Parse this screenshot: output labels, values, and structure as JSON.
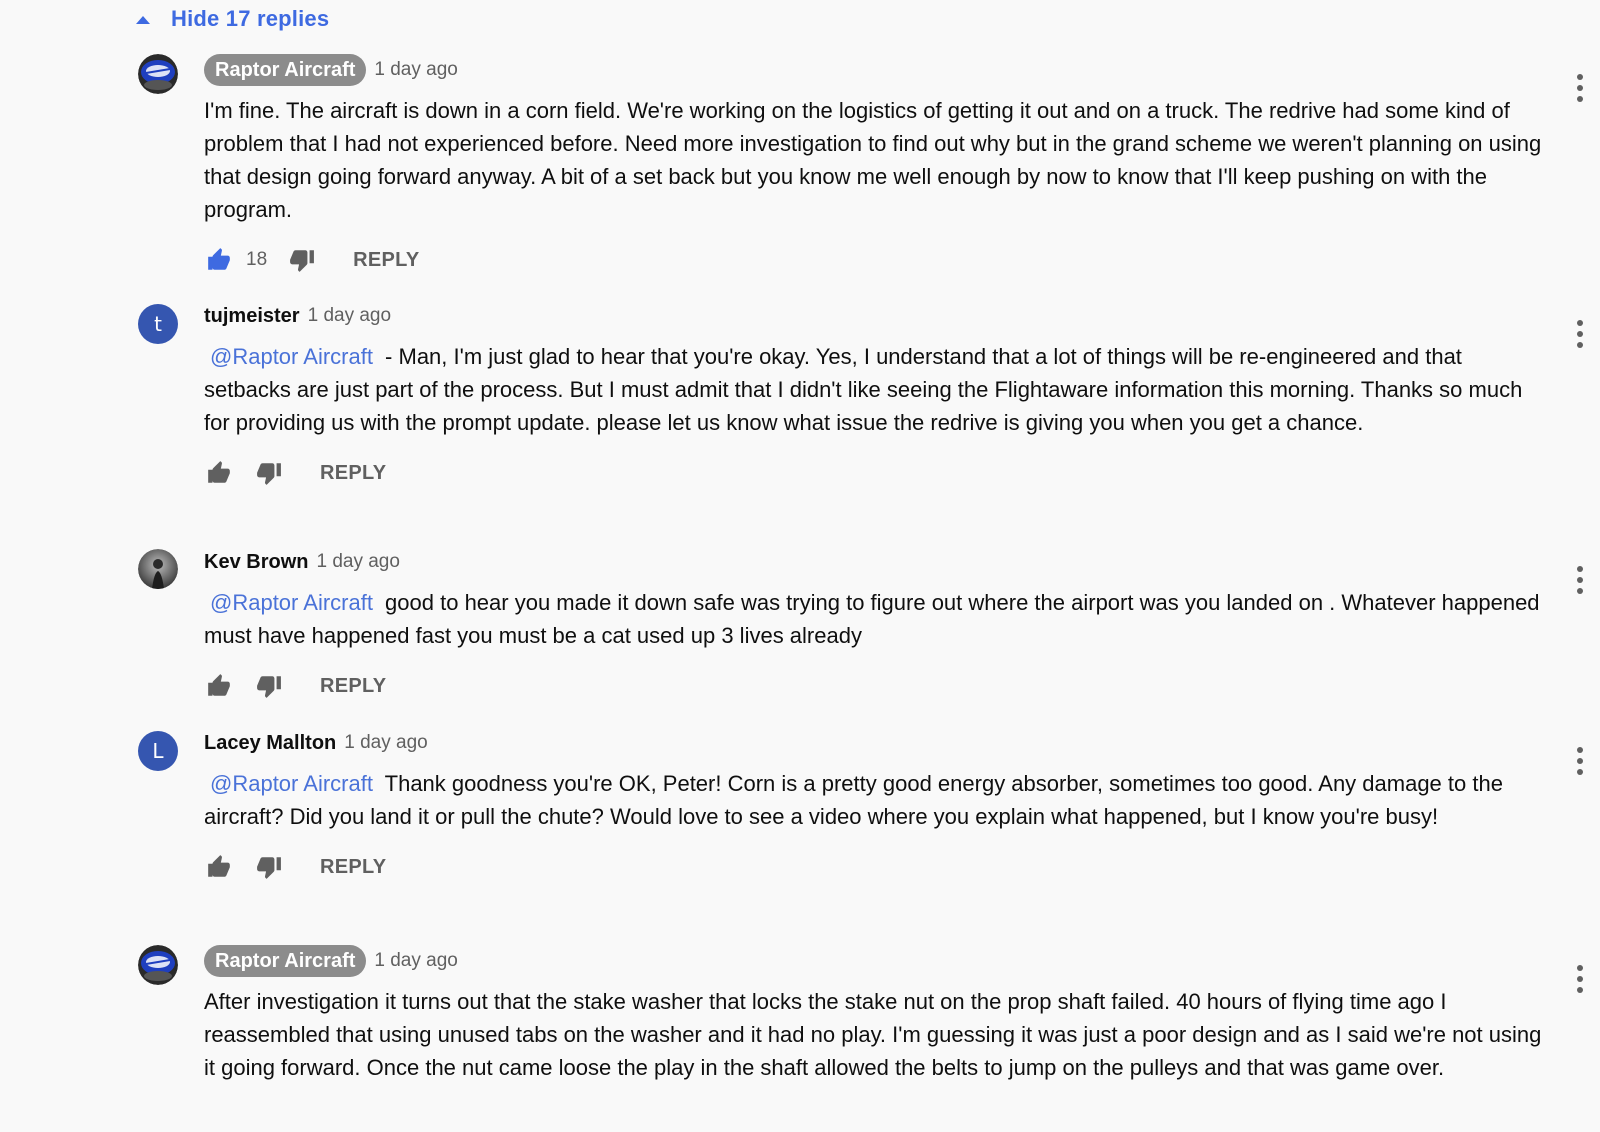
{
  "thread": {
    "hide_replies_label": "Hide 17 replies",
    "accent_color": "#3e6ae1"
  },
  "comments": [
    {
      "author": "Raptor Aircraft",
      "is_channel_owner": true,
      "timestamp": "1 day ago",
      "text": "I'm fine. The aircraft is down in a corn field. We're working on the logistics of getting it out and on a truck. The redrive had some kind of problem that I had not experienced before. Need more investigation to find out why but in the grand scheme we weren't planning on using that design going forward anyway. A bit of a set back but you know me well enough by now to know that I'll keep pushing on with the program.",
      "likes": "18",
      "liked": true,
      "reply_label": "REPLY"
    },
    {
      "author": "tujmeister",
      "avatar_letter": "t",
      "timestamp": "1 day ago",
      "mention": "@Raptor Aircraft",
      "text": " - Man, I'm just glad to hear that you're okay. Yes, I understand that a lot of things will be re-engineered and that setbacks are just part of the process. But I must admit that I didn't like seeing the Flightaware information this morning. Thanks so much for providing us with the prompt update. please let us know what issue the redrive is giving you when you get a chance.",
      "reply_label": "REPLY"
    },
    {
      "author": "Kev Brown",
      "timestamp": "1 day ago",
      "mention": "@Raptor Aircraft",
      "text": " good to hear you made it down safe was trying to figure out where the airport was you landed on . Whatever happened must have happened fast you must be a cat used up 3 lives already",
      "reply_label": "REPLY"
    },
    {
      "author": "Lacey Mallton",
      "avatar_letter": "L",
      "timestamp": "1 day ago",
      "mention": "@Raptor Aircraft",
      "text": " Thank goodness you're OK, Peter! Corn is a pretty good energy absorber, sometimes too good. Any damage to the aircraft? Did you land it or pull the chute? Would love to see a video where you explain what happened, but I know you're busy!",
      "reply_label": "REPLY"
    },
    {
      "author": "Raptor Aircraft",
      "is_channel_owner": true,
      "timestamp": "1 day ago",
      "text": "After investigation it turns out that the stake washer that locks the stake nut on the prop shaft failed. 40 hours of flying time ago I reassembled that using unused tabs on the washer and it had no play. I'm guessing it was just a poor design and as I said we're not using it going forward. Once the nut came loose the play in the shaft allowed the belts to jump on the pulleys and that was game over."
    }
  ]
}
